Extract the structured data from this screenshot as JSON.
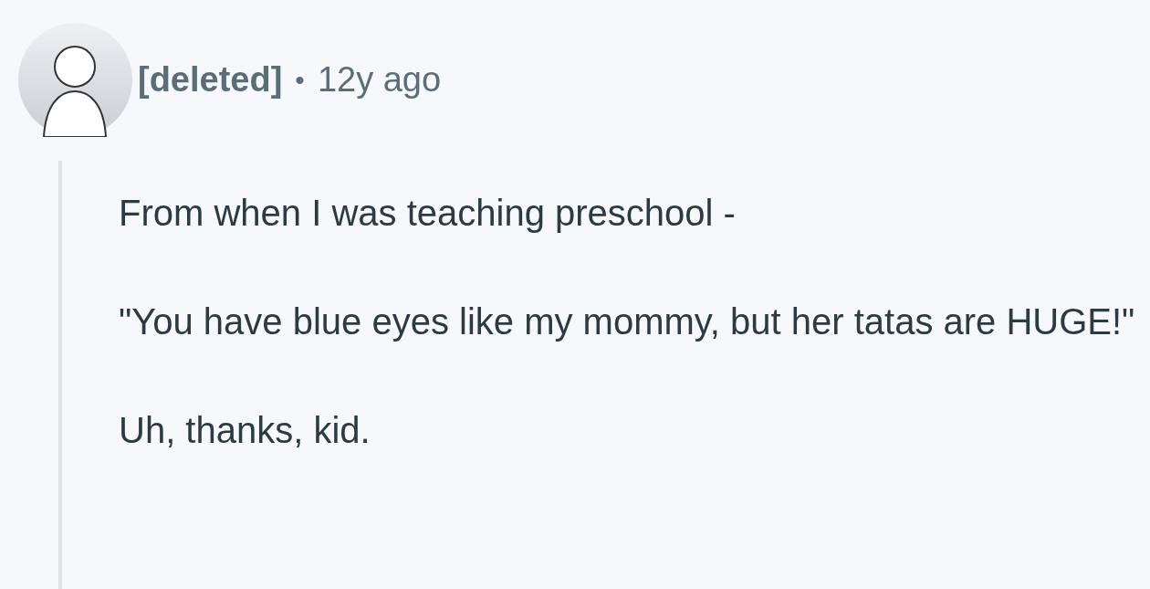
{
  "comment": {
    "author": "[deleted]",
    "separator": "•",
    "age": "12y ago",
    "paragraphs": [
      "From when I was teaching preschool -",
      "\"You have blue eyes like my mommy, but her tatas are HUGE!\"",
      "Uh, thanks, kid."
    ]
  }
}
